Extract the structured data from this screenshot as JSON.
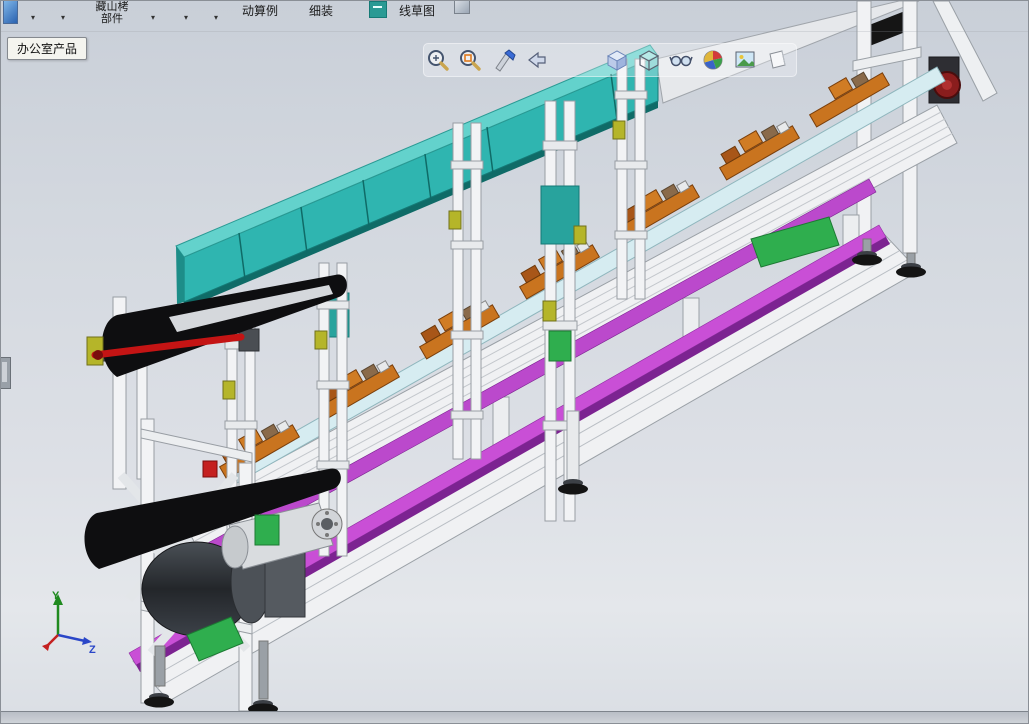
{
  "top_toolbar": {
    "group_button": {
      "line1": "藏山栲",
      "line2": "部件"
    },
    "dropdown_glyph": "▾",
    "items": [
      {
        "label": "动算例"
      },
      {
        "label": "细装"
      },
      {
        "label": "线草图"
      }
    ]
  },
  "office_products_tab": {
    "label": "办公室产品"
  },
  "view_toolbar": {
    "icons": [
      {
        "name": "zoom-to-fit"
      },
      {
        "name": "zoom-to-area"
      },
      {
        "name": "section-view"
      },
      {
        "name": "previous-view"
      },
      {
        "name": "view-orientation"
      },
      {
        "name": "display-style"
      },
      {
        "name": "hide-show-items"
      },
      {
        "name": "edit-appearance"
      },
      {
        "name": "apply-scene"
      },
      {
        "name": "view-settings"
      }
    ]
  },
  "viewport": {
    "triad": {
      "y_label": "Y",
      "z_label": "Z"
    }
  },
  "colors": {
    "teal_cover": "#2fb5b0",
    "magenta_rail": "#c94fd6",
    "magenta_mid_rail": "#bb49cc",
    "orange_pallet": "#c9741f",
    "green_plate": "#2fae4e",
    "frame_white": "#f0f1f3",
    "belt_black": "#0e0e10",
    "shaft_red": "#c41414",
    "axis_y": "#1f8a1f",
    "axis_z": "#2a46c8",
    "axis_x": "#c42020"
  }
}
